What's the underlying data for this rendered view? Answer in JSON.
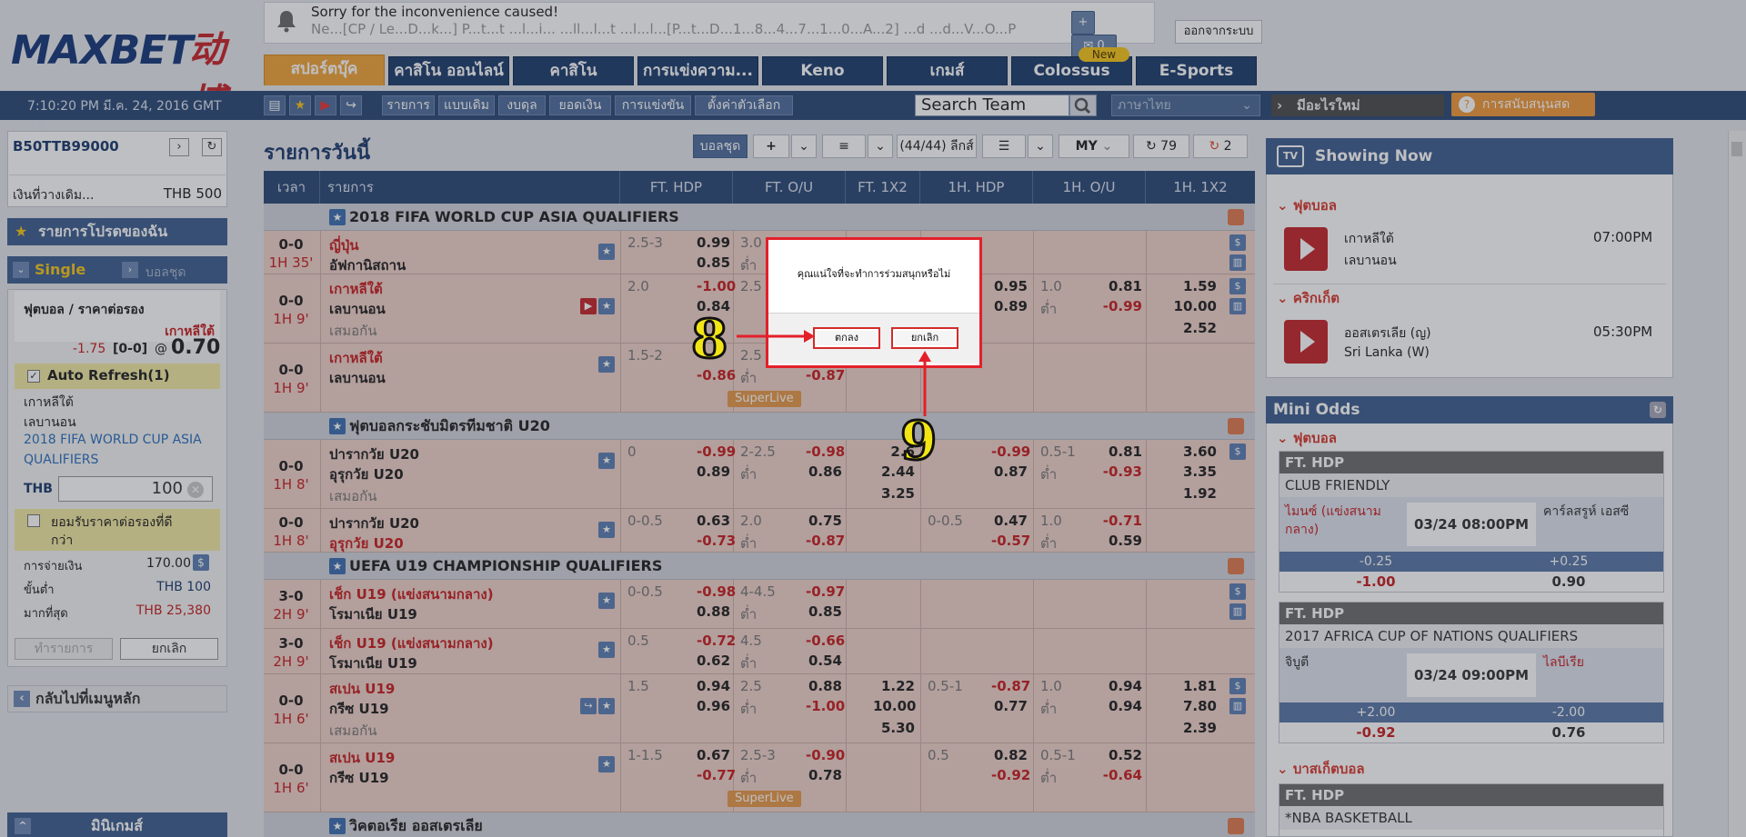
{
  "header": {
    "logo_text": "MAXBET",
    "logo_cn": "动博",
    "notice_line1": "Sorry for the inconvenience caused!",
    "notice_line2": "Ne...[CP / Le...D...k...] P...t...t ...l...i... ...ll...l...t ...l...l...[P...t...D...1...8...4...7...1...0...A...2] ...d ...d...V...O...P",
    "msg_count": "0",
    "logout": "ออกจากระบบ",
    "new_badge": "New"
  },
  "tabs": [
    {
      "label": "สปอร์ตบุ๊ค"
    },
    {
      "label": "คาสิโน ออนไลน์"
    },
    {
      "label": "คาสิโน"
    },
    {
      "label": "การแข่งความ..."
    },
    {
      "label": "Keno"
    },
    {
      "label": "เกมส์"
    },
    {
      "label": "Colossus"
    },
    {
      "label": "E-Sports"
    }
  ],
  "toolbar": {
    "clock": "7:10:20 PM มี.ค. 24, 2016 GMT +8",
    "items": [
      "รายการ",
      "แบบเดิม",
      "งบดุล",
      "ยอดเงิน",
      "การแข่งขัน",
      "ตั้งค่าตัวเลือก"
    ],
    "search_placeholder": "Search Team",
    "language": "ภาษาไทย",
    "whats_new": "มีอะไรใหม่",
    "support": "การสนับสนุนสด"
  },
  "left": {
    "account_id": "B50TTB99000",
    "balance_label": "เงินที่วางเดิม...",
    "balance_value": "THB 500",
    "favorites": "รายการโปรดของฉัน",
    "single": "Single",
    "parlay": "บอลชุด",
    "bet_type": "ฟุตบอล / ราคาต่อรอง",
    "bet_team": "เกาหลีใต้",
    "bet_line": "-1.75",
    "bet_score": "[0-0]",
    "bet_at": "@",
    "bet_odds": "0.70",
    "auto_refresh": "Auto Refresh(1)",
    "home": "เกาหลีใต้",
    "away": "เลบานอน",
    "league_1": "2018 FIFA WORLD CUP ASIA",
    "league_2": "QUALIFIERS",
    "currency": "THB",
    "stake": "100",
    "accept_label_1": "ยอมรับราคาต่อรองที่ดี",
    "accept_label_2": "กว่า",
    "payout_label": "การจ่ายเงิน",
    "payout_value": "170.00",
    "min_label": "ขั้นต่ำ",
    "min_value": "THB 100",
    "max_label": "มากที่สุด",
    "max_value": "THB 25,380",
    "place_bet": "ทำรายการ",
    "cancel": "ยกเลิก",
    "back_menu": "กลับไปที่เมนูหลัก",
    "mini_games": "มินิเกมส์"
  },
  "main": {
    "title": "รายการวันนี้",
    "parlay_btn": "บอลชุด",
    "league_count": "(44/44) ลีกส์",
    "odds_type": "MY",
    "refresh_1": "79",
    "refresh_2": "2",
    "columns": [
      "เวลา",
      "รายการ",
      "FT. HDP",
      "FT. O/U",
      "FT. 1X2",
      "1H. HDP",
      "1H. O/U",
      "1H. 1X2"
    ],
    "leagues": [
      {
        "name": "2018 FIFA WORLD CUP ASIA QUALIFIERS"
      },
      {
        "name": "ฟุตบอลกระชับมิตรทีมชาติ U20"
      },
      {
        "name": "UEFA U19 CHAMPIONSHIP QUALIFIERS"
      },
      {
        "name": "วิคตอเรีย ออสเตรเลีย"
      }
    ],
    "rows": [
      {
        "score": "0-0",
        "time": "1H 35'",
        "home": "ญี่ปุ่น",
        "away": "อัฟกานิสถาน",
        "draw": "",
        "hdp": "2.5-3",
        "hdp_h": "0.99",
        "hdp_a": "0.85",
        "ou": "3.0",
        "ou_u": "ต่ำ",
        "ou_h": "",
        "ou_a": "",
        "x1": "",
        "x2": "",
        "x3": "",
        "h_hdp": "",
        "h_hdp_h": "",
        "h_hdp_a": "",
        "h_ou": "",
        "h_ou_u": "",
        "h_ou_h": "",
        "h_ou_a": "",
        "h1": "",
        "h2": "",
        "h3": ""
      },
      {
        "score": "0-0",
        "time": "1H 9'",
        "home": "เกาหลีใต้",
        "away": "เลบานอน",
        "draw": "เสมอกัน",
        "hdp": "2.0",
        "hdp_h": "-1.00",
        "hdp_a": "0.84",
        "ou": "2.5",
        "ou_u": "",
        "ou_h": "",
        "ou_a": "",
        "x1": "",
        "x2": "",
        "x3": "",
        "h_hdp": "",
        "h_hdp_h": "0.95",
        "h_hdp_a": "0.89",
        "h_ou": "1.0",
        "h_ou_u": "ต่ำ",
        "h_ou_h": "0.81",
        "h_ou_a": "-0.99",
        "h1": "1.59",
        "h2": "10.00",
        "h3": "2.52"
      },
      {
        "score": "0-0",
        "time": "1H 9'",
        "home": "เกาหลีใต้",
        "away": "เลบานอน",
        "draw": "",
        "hdp": "1.5-2",
        "hdp_h": "",
        "hdp_a": "-0.86",
        "ou": "2.5",
        "ou_u": "ต่ำ",
        "ou_h": "",
        "ou_a": "-0.87",
        "x1": "",
        "x2": "",
        "x3": "",
        "h_hdp": "",
        "h_hdp_h": "",
        "h_hdp_a": "",
        "h_ou": "",
        "h_ou_u": "",
        "h_ou_h": "",
        "h_ou_a": "",
        "h1": "",
        "h2": "",
        "h3": "",
        "superlive": "SuperLive"
      },
      {
        "score": "0-0",
        "time": "1H 8'",
        "home": "ปารากวัย U20",
        "away": "อุรุกวัย U20",
        "draw": "เสมอกัน",
        "hdp": "0",
        "hdp_h": "-0.99",
        "hdp_a": "0.89",
        "ou": "2-2.5",
        "ou_u": "ต่ำ",
        "ou_h": "-0.98",
        "ou_a": "0.86",
        "x1": "2.6",
        "x2": "2.44",
        "x3": "3.25",
        "h_hdp": "",
        "h_hdp_h": "-0.99",
        "h_hdp_a": "0.87",
        "h_ou": "0.5-1",
        "h_ou_u": "ต่ำ",
        "h_ou_h": "0.81",
        "h_ou_a": "-0.93",
        "h1": "3.60",
        "h2": "3.35",
        "h3": "1.92"
      },
      {
        "score": "0-0",
        "time": "1H 8'",
        "home": "ปารากวัย U20",
        "away": "อุรุกวัย U20",
        "draw": "",
        "hdp": "0-0.5",
        "hdp_h": "0.63",
        "hdp_a": "-0.73",
        "ou": "2.0",
        "ou_u": "ต่ำ",
        "ou_h": "0.75",
        "ou_a": "-0.87",
        "x1": "",
        "x2": "",
        "x3": "",
        "h_hdp": "0-0.5",
        "h_hdp_h": "0.47",
        "h_hdp_a": "-0.57",
        "h_ou": "1.0",
        "h_ou_u": "ต่ำ",
        "h_ou_h": "-0.71",
        "h_ou_a": "0.59",
        "h1": "",
        "h2": "",
        "h3": ""
      },
      {
        "score": "3-0",
        "time": "2H 9'",
        "home": "เช็ก U19 (แข่งสนามกลาง)",
        "away": "โรมาเนีย U19",
        "draw": "",
        "hdp": "0-0.5",
        "hdp_h": "-0.98",
        "hdp_a": "0.88",
        "ou": "4-4.5",
        "ou_u": "ต่ำ",
        "ou_h": "-0.97",
        "ou_a": "0.85",
        "x1": "",
        "x2": "",
        "x3": "",
        "h_hdp": "",
        "h_hdp_h": "",
        "h_hdp_a": "",
        "h_ou": "",
        "h_ou_u": "",
        "h_ou_h": "",
        "h_ou_a": "",
        "h1": "",
        "h2": "",
        "h3": ""
      },
      {
        "score": "3-0",
        "time": "2H 9'",
        "home": "เช็ก U19 (แข่งสนามกลาง)",
        "away": "โรมาเนีย U19",
        "draw": "",
        "hdp": "0.5",
        "hdp_h": "-0.72",
        "hdp_a": "0.62",
        "ou": "4.5",
        "ou_u": "ต่ำ",
        "ou_h": "-0.66",
        "ou_a": "0.54",
        "x1": "",
        "x2": "",
        "x3": "",
        "h_hdp": "",
        "h_hdp_h": "",
        "h_hdp_a": "",
        "h_ou": "",
        "h_ou_u": "",
        "h_ou_h": "",
        "h_ou_a": "",
        "h1": "",
        "h2": "",
        "h3": ""
      },
      {
        "score": "0-0",
        "time": "1H 6'",
        "home": "สเปน U19",
        "away": "กรีซ U19",
        "draw": "เสมอกัน",
        "hdp": "1.5",
        "hdp_h": "0.94",
        "hdp_a": "0.96",
        "ou": "2.5",
        "ou_u": "ต่ำ",
        "ou_h": "0.88",
        "ou_a": "-1.00",
        "x1": "1.22",
        "x2": "10.00",
        "x3": "5.30",
        "h_hdp": "0.5-1",
        "h_hdp_h": "-0.87",
        "h_hdp_a": "0.77",
        "h_ou": "1.0",
        "h_ou_u": "ต่ำ",
        "h_ou_h": "0.94",
        "h_ou_a": "0.94",
        "h1": "1.81",
        "h2": "7.80",
        "h3": "2.39"
      },
      {
        "score": "0-0",
        "time": "1H 6'",
        "home": "สเปน U19",
        "away": "กรีซ U19",
        "draw": "",
        "hdp": "1-1.5",
        "hdp_h": "0.67",
        "hdp_a": "-0.77",
        "ou": "2.5-3",
        "ou_u": "ต่ำ",
        "ou_h": "-0.90",
        "ou_a": "0.78",
        "x1": "",
        "x2": "",
        "x3": "",
        "h_hdp": "0.5",
        "h_hdp_h": "0.82",
        "h_hdp_a": "-0.92",
        "h_ou": "0.5-1",
        "h_ou_u": "ต่ำ",
        "h_ou_h": "0.52",
        "h_ou_a": "-0.64",
        "h1": "",
        "h2": "",
        "h3": "",
        "superlive": "SuperLive"
      }
    ]
  },
  "right": {
    "showing_now": "Showing Now",
    "sec_football": "ฟุตบอล",
    "sec_cricket": "คริกเก็ต",
    "match1_home": "เกาหลีใต้",
    "match1_away": "เลบานอน",
    "match1_time": "07:00PM",
    "match2_home": "ออสเตรเลีย (ญ)",
    "match2_away": "Sri Lanka (W)",
    "match2_time": "05:30PM",
    "mini_odds": "Mini Odds",
    "mini_sec1": "ฟุตบอล",
    "card1_type": "FT. HDP",
    "card1_league": "CLUB FRIENDLY",
    "card1_home": "ไมนซ์ (แข่งสนามกลาง)",
    "card1_date": "03/24 08:00PM",
    "card1_away": "คาร์ลสรูห์ เอสซี",
    "card1_l1": "-0.25",
    "card1_l2": "+0.25",
    "card1_o1": "-1.00",
    "card1_o2": "0.90",
    "card2_type": "FT. HDP",
    "card2_league": "2017 AFRICA CUP OF NATIONS QUALIFIERS",
    "card2_home": "จิบูตี",
    "card2_date": "03/24 09:00PM",
    "card2_away": "ไลบีเรีย",
    "card2_l1": "+2.00",
    "card2_l2": "-2.00",
    "card2_o1": "-0.92",
    "card2_o2": "0.76",
    "mini_sec2": "บาสเก็ตบอล",
    "card3_type": "FT. HDP",
    "card3_league": "*NBA BASKETBALL"
  },
  "dialog": {
    "message": "คุณแน่ใจที่จะทำการร่วมสนุกหรือไม่",
    "ok": "ตกลง",
    "cancel": "ยกเลิก",
    "callout_ok": "8",
    "callout_cancel": "9"
  }
}
